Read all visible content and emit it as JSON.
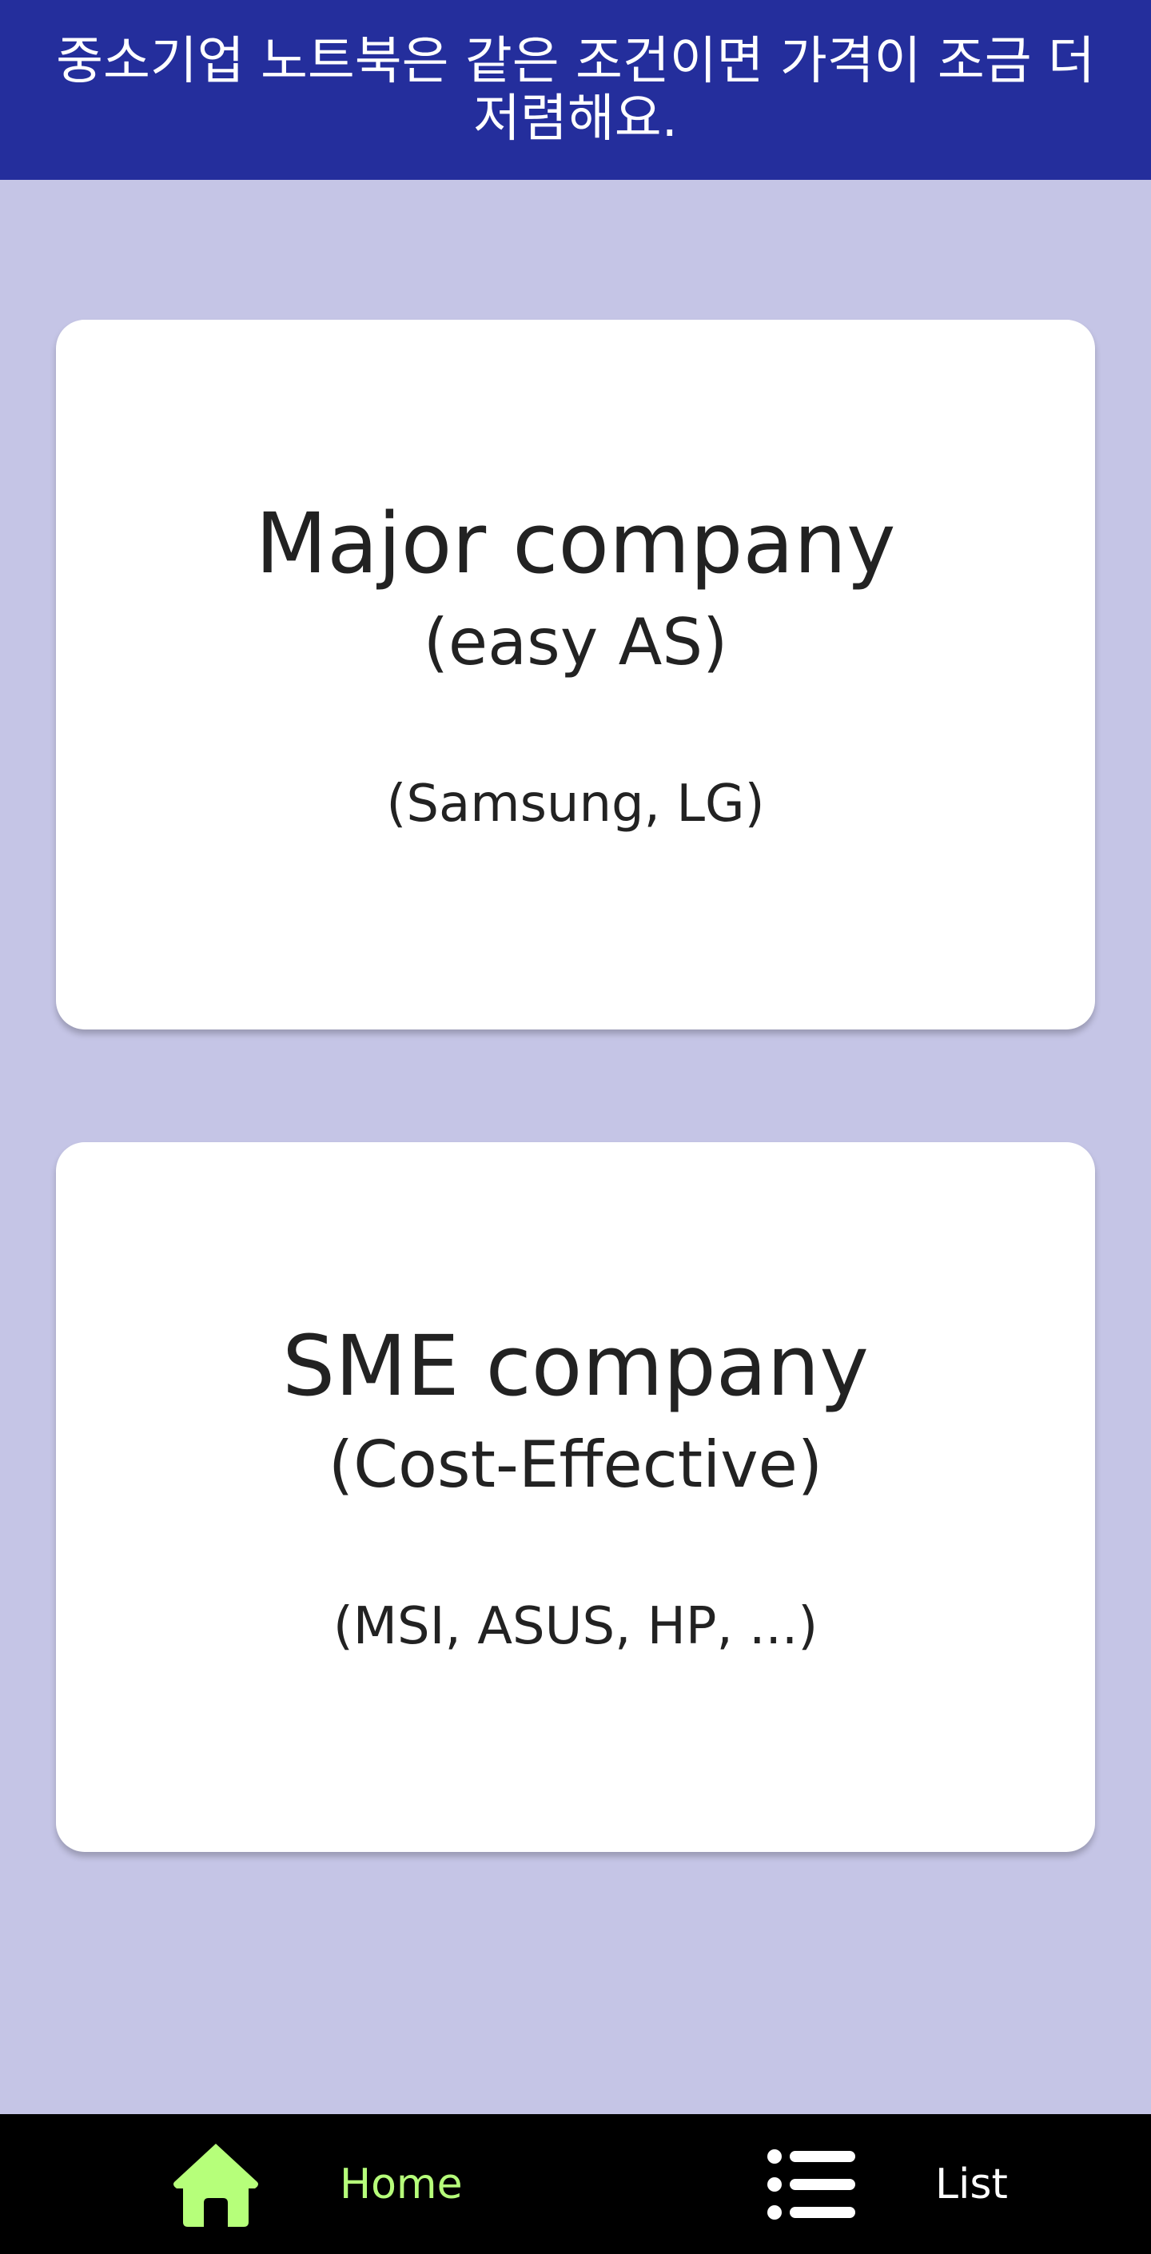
{
  "header": {
    "message": "중소기업 노트북은 같은 조건이면 가격이 조금 더 저렴해요."
  },
  "cards": [
    {
      "title": "Major company",
      "subtitle": "(easy AS)",
      "brands": "(Samsung, LG)"
    },
    {
      "title": "SME company",
      "subtitle": "(Cost-Effective)",
      "brands": "(MSI, ASUS, HP, ...)"
    }
  ],
  "nav": {
    "home": {
      "label": "Home",
      "icon": "home-icon",
      "active": true
    },
    "list": {
      "label": "List",
      "icon": "list-icon",
      "active": false
    }
  },
  "colors": {
    "header_bg": "#242e9c",
    "page_bg": "#c5c5e6",
    "nav_bg": "#000000",
    "nav_active": "#b6ff7a",
    "nav_inactive": "#ffffff"
  }
}
